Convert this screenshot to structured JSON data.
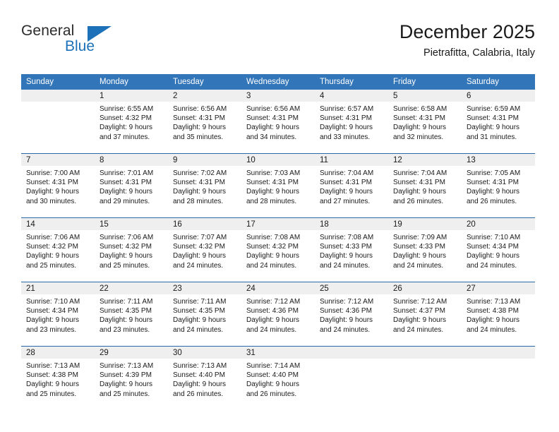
{
  "brand": {
    "name_part1": "General",
    "name_part2": "Blue",
    "flag_icon": "triangle-flag-icon"
  },
  "header": {
    "title": "December 2025",
    "subtitle": "Pietrafitta, Calabria, Italy"
  },
  "colors": {
    "header_blue": "#3275b8",
    "brand_blue": "#1c71b8",
    "row_divider": "#2a69a8",
    "daynum_band": "#efefef",
    "text": "#1a1a1a"
  },
  "weekday_headers": [
    "Sunday",
    "Monday",
    "Tuesday",
    "Wednesday",
    "Thursday",
    "Friday",
    "Saturday"
  ],
  "weeks": [
    [
      {
        "day": "",
        "sunrise": "",
        "sunset": "",
        "daylight_line1": "",
        "daylight_line2": "",
        "empty": true
      },
      {
        "day": "1",
        "sunrise": "Sunrise: 6:55 AM",
        "sunset": "Sunset: 4:32 PM",
        "daylight_line1": "Daylight: 9 hours",
        "daylight_line2": "and 37 minutes.",
        "empty": false
      },
      {
        "day": "2",
        "sunrise": "Sunrise: 6:56 AM",
        "sunset": "Sunset: 4:31 PM",
        "daylight_line1": "Daylight: 9 hours",
        "daylight_line2": "and 35 minutes.",
        "empty": false
      },
      {
        "day": "3",
        "sunrise": "Sunrise: 6:56 AM",
        "sunset": "Sunset: 4:31 PM",
        "daylight_line1": "Daylight: 9 hours",
        "daylight_line2": "and 34 minutes.",
        "empty": false
      },
      {
        "day": "4",
        "sunrise": "Sunrise: 6:57 AM",
        "sunset": "Sunset: 4:31 PM",
        "daylight_line1": "Daylight: 9 hours",
        "daylight_line2": "and 33 minutes.",
        "empty": false
      },
      {
        "day": "5",
        "sunrise": "Sunrise: 6:58 AM",
        "sunset": "Sunset: 4:31 PM",
        "daylight_line1": "Daylight: 9 hours",
        "daylight_line2": "and 32 minutes.",
        "empty": false
      },
      {
        "day": "6",
        "sunrise": "Sunrise: 6:59 AM",
        "sunset": "Sunset: 4:31 PM",
        "daylight_line1": "Daylight: 9 hours",
        "daylight_line2": "and 31 minutes.",
        "empty": false
      }
    ],
    [
      {
        "day": "7",
        "sunrise": "Sunrise: 7:00 AM",
        "sunset": "Sunset: 4:31 PM",
        "daylight_line1": "Daylight: 9 hours",
        "daylight_line2": "and 30 minutes.",
        "empty": false
      },
      {
        "day": "8",
        "sunrise": "Sunrise: 7:01 AM",
        "sunset": "Sunset: 4:31 PM",
        "daylight_line1": "Daylight: 9 hours",
        "daylight_line2": "and 29 minutes.",
        "empty": false
      },
      {
        "day": "9",
        "sunrise": "Sunrise: 7:02 AM",
        "sunset": "Sunset: 4:31 PM",
        "daylight_line1": "Daylight: 9 hours",
        "daylight_line2": "and 28 minutes.",
        "empty": false
      },
      {
        "day": "10",
        "sunrise": "Sunrise: 7:03 AM",
        "sunset": "Sunset: 4:31 PM",
        "daylight_line1": "Daylight: 9 hours",
        "daylight_line2": "and 28 minutes.",
        "empty": false
      },
      {
        "day": "11",
        "sunrise": "Sunrise: 7:04 AM",
        "sunset": "Sunset: 4:31 PM",
        "daylight_line1": "Daylight: 9 hours",
        "daylight_line2": "and 27 minutes.",
        "empty": false
      },
      {
        "day": "12",
        "sunrise": "Sunrise: 7:04 AM",
        "sunset": "Sunset: 4:31 PM",
        "daylight_line1": "Daylight: 9 hours",
        "daylight_line2": "and 26 minutes.",
        "empty": false
      },
      {
        "day": "13",
        "sunrise": "Sunrise: 7:05 AM",
        "sunset": "Sunset: 4:31 PM",
        "daylight_line1": "Daylight: 9 hours",
        "daylight_line2": "and 26 minutes.",
        "empty": false
      }
    ],
    [
      {
        "day": "14",
        "sunrise": "Sunrise: 7:06 AM",
        "sunset": "Sunset: 4:32 PM",
        "daylight_line1": "Daylight: 9 hours",
        "daylight_line2": "and 25 minutes.",
        "empty": false
      },
      {
        "day": "15",
        "sunrise": "Sunrise: 7:06 AM",
        "sunset": "Sunset: 4:32 PM",
        "daylight_line1": "Daylight: 9 hours",
        "daylight_line2": "and 25 minutes.",
        "empty": false
      },
      {
        "day": "16",
        "sunrise": "Sunrise: 7:07 AM",
        "sunset": "Sunset: 4:32 PM",
        "daylight_line1": "Daylight: 9 hours",
        "daylight_line2": "and 24 minutes.",
        "empty": false
      },
      {
        "day": "17",
        "sunrise": "Sunrise: 7:08 AM",
        "sunset": "Sunset: 4:32 PM",
        "daylight_line1": "Daylight: 9 hours",
        "daylight_line2": "and 24 minutes.",
        "empty": false
      },
      {
        "day": "18",
        "sunrise": "Sunrise: 7:08 AM",
        "sunset": "Sunset: 4:33 PM",
        "daylight_line1": "Daylight: 9 hours",
        "daylight_line2": "and 24 minutes.",
        "empty": false
      },
      {
        "day": "19",
        "sunrise": "Sunrise: 7:09 AM",
        "sunset": "Sunset: 4:33 PM",
        "daylight_line1": "Daylight: 9 hours",
        "daylight_line2": "and 24 minutes.",
        "empty": false
      },
      {
        "day": "20",
        "sunrise": "Sunrise: 7:10 AM",
        "sunset": "Sunset: 4:34 PM",
        "daylight_line1": "Daylight: 9 hours",
        "daylight_line2": "and 24 minutes.",
        "empty": false
      }
    ],
    [
      {
        "day": "21",
        "sunrise": "Sunrise: 7:10 AM",
        "sunset": "Sunset: 4:34 PM",
        "daylight_line1": "Daylight: 9 hours",
        "daylight_line2": "and 23 minutes.",
        "empty": false
      },
      {
        "day": "22",
        "sunrise": "Sunrise: 7:11 AM",
        "sunset": "Sunset: 4:35 PM",
        "daylight_line1": "Daylight: 9 hours",
        "daylight_line2": "and 23 minutes.",
        "empty": false
      },
      {
        "day": "23",
        "sunrise": "Sunrise: 7:11 AM",
        "sunset": "Sunset: 4:35 PM",
        "daylight_line1": "Daylight: 9 hours",
        "daylight_line2": "and 24 minutes.",
        "empty": false
      },
      {
        "day": "24",
        "sunrise": "Sunrise: 7:12 AM",
        "sunset": "Sunset: 4:36 PM",
        "daylight_line1": "Daylight: 9 hours",
        "daylight_line2": "and 24 minutes.",
        "empty": false
      },
      {
        "day": "25",
        "sunrise": "Sunrise: 7:12 AM",
        "sunset": "Sunset: 4:36 PM",
        "daylight_line1": "Daylight: 9 hours",
        "daylight_line2": "and 24 minutes.",
        "empty": false
      },
      {
        "day": "26",
        "sunrise": "Sunrise: 7:12 AM",
        "sunset": "Sunset: 4:37 PM",
        "daylight_line1": "Daylight: 9 hours",
        "daylight_line2": "and 24 minutes.",
        "empty": false
      },
      {
        "day": "27",
        "sunrise": "Sunrise: 7:13 AM",
        "sunset": "Sunset: 4:38 PM",
        "daylight_line1": "Daylight: 9 hours",
        "daylight_line2": "and 24 minutes.",
        "empty": false
      }
    ],
    [
      {
        "day": "28",
        "sunrise": "Sunrise: 7:13 AM",
        "sunset": "Sunset: 4:38 PM",
        "daylight_line1": "Daylight: 9 hours",
        "daylight_line2": "and 25 minutes.",
        "empty": false
      },
      {
        "day": "29",
        "sunrise": "Sunrise: 7:13 AM",
        "sunset": "Sunset: 4:39 PM",
        "daylight_line1": "Daylight: 9 hours",
        "daylight_line2": "and 25 minutes.",
        "empty": false
      },
      {
        "day": "30",
        "sunrise": "Sunrise: 7:13 AM",
        "sunset": "Sunset: 4:40 PM",
        "daylight_line1": "Daylight: 9 hours",
        "daylight_line2": "and 26 minutes.",
        "empty": false
      },
      {
        "day": "31",
        "sunrise": "Sunrise: 7:14 AM",
        "sunset": "Sunset: 4:40 PM",
        "daylight_line1": "Daylight: 9 hours",
        "daylight_line2": "and 26 minutes.",
        "empty": false
      },
      {
        "day": "",
        "sunrise": "",
        "sunset": "",
        "daylight_line1": "",
        "daylight_line2": "",
        "empty": true
      },
      {
        "day": "",
        "sunrise": "",
        "sunset": "",
        "daylight_line1": "",
        "daylight_line2": "",
        "empty": true
      },
      {
        "day": "",
        "sunrise": "",
        "sunset": "",
        "daylight_line1": "",
        "daylight_line2": "",
        "empty": true
      }
    ]
  ]
}
